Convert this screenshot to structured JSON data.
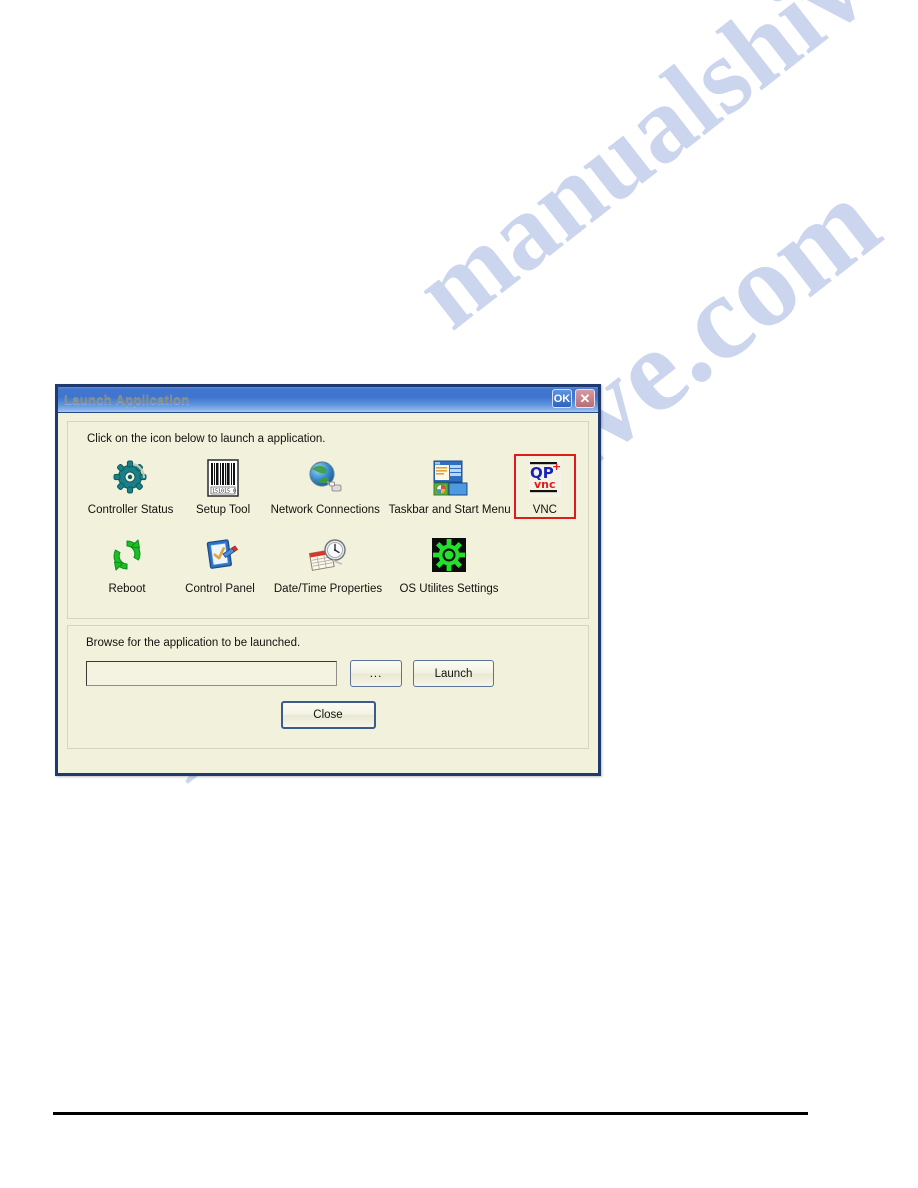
{
  "page": {
    "watermark_text": "manualshive.com"
  },
  "dialog": {
    "title": "Launch Application",
    "titlebar_buttons": {
      "ok_label": "OK",
      "close_label": "✕"
    },
    "colors": {
      "titlebar_blue": "#3f74cf",
      "window_border": "#1f3a6e",
      "dialog_background": "#f2f1dc",
      "selection_red": "#e01b1b",
      "ok_button_blue": "#2f63bd",
      "close_button_red": "#b96d76"
    },
    "icons_group": {
      "hint": "Click on the icon below to launch a application.",
      "row1": [
        {
          "label": "Controller Status",
          "icon": "gear-icon",
          "selected": false
        },
        {
          "label": "Setup Tool",
          "icon": "barcode-icon",
          "selected": false
        },
        {
          "label": "Network Connections",
          "icon": "globe-network-icon",
          "selected": false
        },
        {
          "label": "Taskbar and Start Menu",
          "icon": "taskbar-window-icon",
          "selected": false
        },
        {
          "label": "VNC",
          "icon": "qp-vnc-icon",
          "selected": true
        }
      ],
      "row2": [
        {
          "label": "Reboot",
          "icon": "refresh-arrows-icon",
          "selected": false
        },
        {
          "label": "Control Panel",
          "icon": "checklist-pen-icon",
          "selected": false
        },
        {
          "label": "Date/Time Properties",
          "icon": "calendar-clock-icon",
          "selected": false
        },
        {
          "label": "OS Utilites Settings",
          "icon": "green-gear-square-icon",
          "selected": false
        }
      ],
      "vnc_icon_text": {
        "top": "QP",
        "plus": "+",
        "bottom": "vnc"
      },
      "barcode_digits": "151015 0"
    },
    "browse_group": {
      "label": "Browse for the application to be launched.",
      "path_value": "",
      "path_placeholder": "",
      "browse_button": "...",
      "launch_button": "Launch"
    },
    "close_button": "Close"
  }
}
